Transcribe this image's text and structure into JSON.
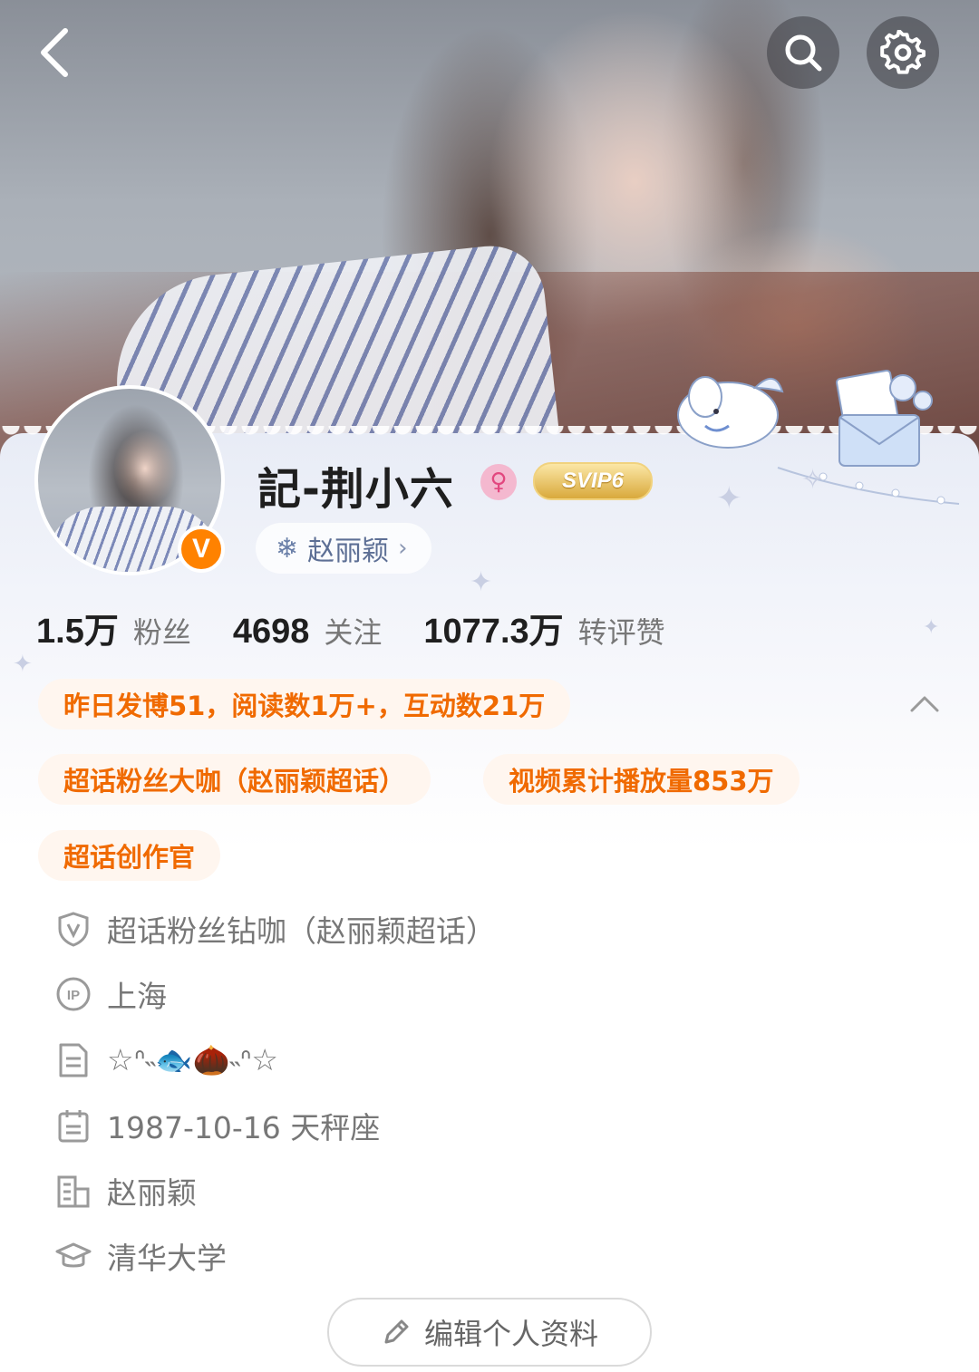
{
  "header": {
    "back_icon": "chevron-left-icon",
    "search_icon": "search-icon",
    "settings_icon": "gear-icon"
  },
  "profile": {
    "name": "記-荆小六",
    "gender_symbol": "♀",
    "vip_badge": "SVIP6",
    "verified_badge": "V",
    "super_topic_tag": "赵丽颖",
    "super_topic_icon": "snowflake-icon"
  },
  "stats": [
    {
      "value": "1.5万",
      "label": "粉丝"
    },
    {
      "value": "4698",
      "label": "关注"
    },
    {
      "value": "1077.3万",
      "label": "转评赞"
    }
  ],
  "achievements": [
    "昨日发博51，阅读数1万+，互动数21万",
    "超话粉丝大咖（赵丽颖超话）",
    "视频累计播放量853万",
    "超话创作官"
  ],
  "info": [
    {
      "icon": "shield-v-icon",
      "text": "超话粉丝钻咖（赵丽颖超话）"
    },
    {
      "icon": "ip-icon",
      "text": "上海"
    },
    {
      "icon": "document-icon",
      "text": "☆ᐢ˵🐟🌰˵ᐢ☆"
    },
    {
      "icon": "calendar-icon",
      "text": "1987-10-16 天秤座"
    },
    {
      "icon": "company-icon",
      "text": "赵丽颖"
    },
    {
      "icon": "graduation-cap-icon",
      "text": "清华大学"
    }
  ],
  "edit_button": {
    "label": "编辑个人资料",
    "icon": "pencil-icon"
  },
  "colors": {
    "accent_orange": "#f06a00",
    "verified": "#ff8200",
    "chip_bg": "#fff6ee"
  }
}
